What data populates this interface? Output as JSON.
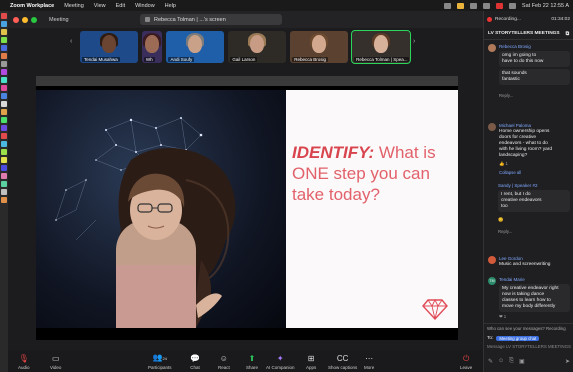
{
  "menubar": {
    "app": "Zoom Workplace",
    "items": [
      "Meeting",
      "View",
      "Edit",
      "Window",
      "Help"
    ],
    "clock": "Sat Feb 22  12:55 A"
  },
  "window": {
    "title": "Meeting",
    "share_tab": "Rebecca Tolman | ...'s screen"
  },
  "gallery": [
    {
      "name": "Tendai Musahwa",
      "face": "#6b4432",
      "hair": "#2e1b12",
      "bg": "#1e4a8a"
    },
    {
      "name": "Wh",
      "face": "#9b6b55",
      "hair": "#3a1a22",
      "bg": "#3a2f5c"
    },
    {
      "name": "Andi Soufy",
      "face": "#c9a088",
      "hair": "#7b7b7b",
      "bg": "#1f5fa9"
    },
    {
      "name": "Gail Larson",
      "face": "#c79b84",
      "hair": "#9a7a55",
      "bg": "#2e2a26"
    },
    {
      "name": "Rebecca Brosig",
      "face": "#d2a98e",
      "hair": "#6b4a2f",
      "bg": "#5a4130"
    },
    {
      "name": "Rebecca Tolman | Spea...",
      "face": "#d8b19a",
      "hair": "#5b3b27",
      "bg": "#35302c"
    }
  ],
  "slide": {
    "keyword": "IDENTIFY:",
    "line1": " What is",
    "line2": "ONE step you can",
    "line3": "take today?"
  },
  "sidebar": {
    "recording": "Recording...",
    "time": "01:34:02",
    "chat_title": "LV STORYTELLERS MEETINGS",
    "messages": [
      {
        "who": "Rebecca Brosig",
        "lines": [
          "omg im going to",
          "have to do this now"
        ],
        "extra": [
          "that sounds",
          "fantastic"
        ],
        "reply": "Reply..."
      },
      {
        "who": "Michael Paloma",
        "lines": [
          "Home ownership opens",
          "doors for creative",
          "endeavors - what to do",
          "with he living room? yard",
          "landscaping?"
        ],
        "react": "1",
        "collapse": "Collapse all"
      },
      {
        "who": "Sandy | Speaker #2",
        "lines": [
          "I rent, but I do",
          "creative endeavors",
          "too"
        ],
        "reply": "Reply..."
      },
      {
        "who": "Lee Gordon",
        "lines": [
          "Music and screenwriting"
        ],
        "reply": ""
      },
      {
        "who": "Tendai Marie",
        "initials": "TM",
        "lines": [
          "My creative endeavor right",
          "now is taking dance",
          "classes to learn how to",
          "move my body differently"
        ],
        "react": "1"
      }
    ],
    "who_can_see": "Who can see your messages? Recording",
    "to_label": "To:",
    "to_chip": "Meeting group chat",
    "placeholder": "Message LV STORYTELLERS MEETINGS"
  },
  "toolbar": {
    "audio": "Audio",
    "video": "Video",
    "participants": "Participants",
    "participants_count": "24",
    "chat": "Chat",
    "react": "React",
    "share": "Share",
    "ai": "AI Companion",
    "apps": "Apps",
    "captions": "Show captions",
    "more": "More",
    "leave": "Leave"
  }
}
